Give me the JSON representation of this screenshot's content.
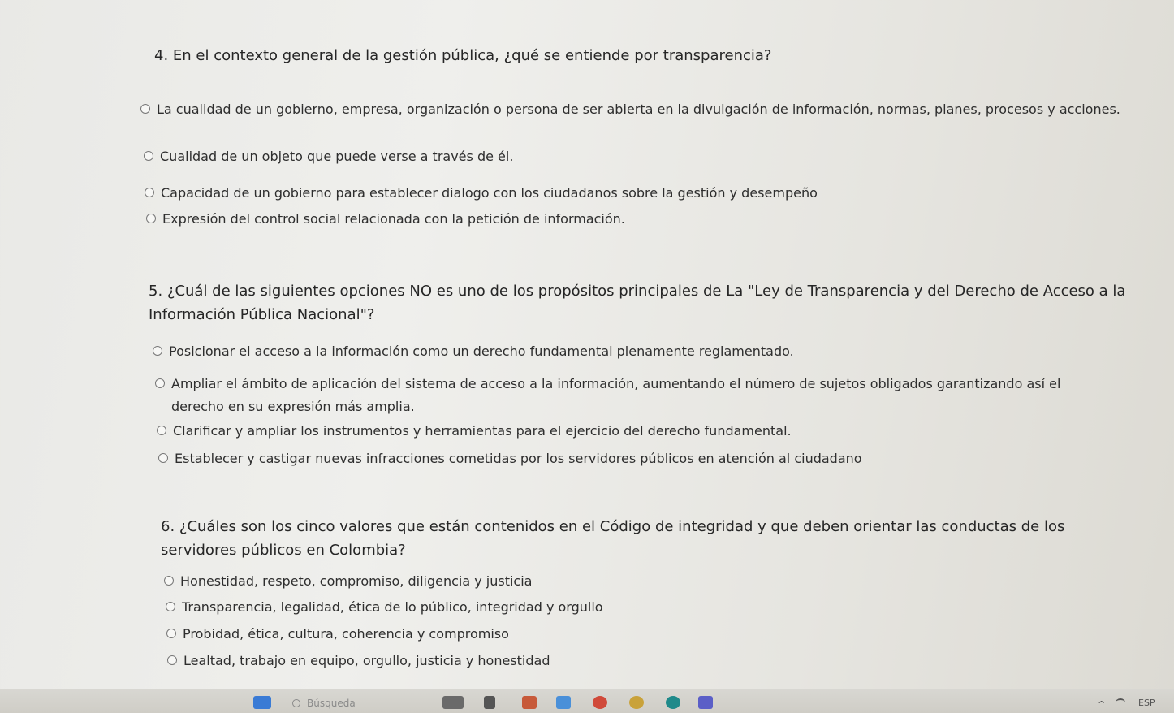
{
  "questions": [
    {
      "title": "4. En el contexto general de la gestión pública, ¿qué se entiende por transparencia?",
      "options": [
        "La cualidad de un gobierno, empresa, organización o persona de ser abierta en la divulgación de información, normas, planes, procesos y acciones.",
        "Cualidad de un objeto que puede verse a través de él.",
        "Capacidad de un gobierno para establecer dialogo con los ciudadanos sobre la gestión y desempeño",
        "Expresión del control social relacionada con la petición de información."
      ]
    },
    {
      "title": "5. ¿Cuál de las siguientes opciones NO es uno de los propósitos principales de La \"Ley de Transparencia y del Derecho de Acceso a la Información Pública Nacional\"?",
      "options": [
        "Posicionar el acceso a la información como un derecho fundamental plenamente reglamentado.",
        "Ampliar el ámbito de aplicación del sistema de acceso a la información, aumentando el número de sujetos obligados garantizando así el derecho en su expresión más amplia.",
        "Clarificar y ampliar los instrumentos y herramientas para el ejercicio del derecho fundamental.",
        "Establecer y castigar nuevas infracciones cometidas por los servidores públicos en atención al ciudadano"
      ]
    },
    {
      "title": "6. ¿Cuáles son los cinco valores que están contenidos en el Código de integridad y que deben orientar las conductas de los servidores públicos en Colombia?",
      "options": [
        "Honestidad, respeto, compromiso, diligencia y justicia",
        "Transparencia, legalidad, ética de lo público, integridad y orgullo",
        "Probidad, ética, cultura, coherencia y compromiso",
        "Lealtad, trabajo en equipo, orgullo, justicia y honestidad"
      ]
    }
  ],
  "taskbar": {
    "search_placeholder": "Búsqueda",
    "language": "ESP",
    "icons": [
      "start-icon",
      "search-icon",
      "task-view-icon",
      "file-explorer-icon",
      "app-icon",
      "store-icon",
      "chrome-icon",
      "edge-icon",
      "teams-icon"
    ]
  }
}
